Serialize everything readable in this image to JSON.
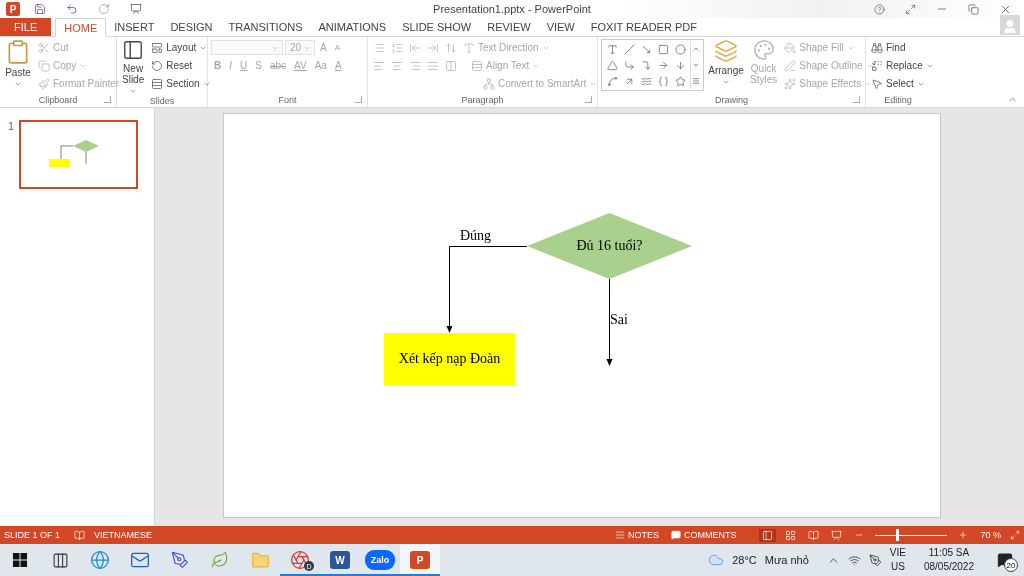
{
  "title_bar": {
    "app_letter": "P",
    "title": "Presentation1.pptx - PowerPoint"
  },
  "tabs": [
    {
      "label": "FILE",
      "kind": "file",
      "selected": false
    },
    {
      "label": "HOME",
      "kind": "tab",
      "selected": true
    },
    {
      "label": "INSERT",
      "kind": "tab",
      "selected": false
    },
    {
      "label": "DESIGN",
      "kind": "tab",
      "selected": false
    },
    {
      "label": "TRANSITIONS",
      "kind": "tab",
      "selected": false
    },
    {
      "label": "ANIMATIONS",
      "kind": "tab",
      "selected": false
    },
    {
      "label": "SLIDE SHOW",
      "kind": "tab",
      "selected": false
    },
    {
      "label": "REVIEW",
      "kind": "tab",
      "selected": false
    },
    {
      "label": "VIEW",
      "kind": "tab",
      "selected": false
    },
    {
      "label": "FOXIT READER PDF",
      "kind": "tab",
      "selected": false
    }
  ],
  "ribbon": {
    "clipboard": {
      "label": "Clipboard",
      "paste": {
        "label": "Paste",
        "disabled": false
      },
      "cut": {
        "label": "Cut",
        "disabled": true
      },
      "copy": {
        "label": "Copy",
        "disabled": true
      },
      "format_painter": {
        "label": "Format Painter",
        "disabled": true
      }
    },
    "slides": {
      "label": "Slides",
      "new_slide": {
        "label": "New Slide",
        "disabled": false
      },
      "layout": {
        "label": "Layout",
        "disabled": false
      },
      "reset": {
        "label": "Reset",
        "disabled": false
      },
      "section": {
        "label": "Section",
        "disabled": false
      }
    },
    "font": {
      "label": "Font",
      "disabled": true,
      "font_size": "20",
      "grow": "A",
      "shrink": "A",
      "format_buttons": [
        "B",
        "I",
        "U",
        "S",
        "abc",
        "AV",
        "Aa"
      ],
      "font_color": "A"
    },
    "paragraph": {
      "label": "Paragraph",
      "disabled": true,
      "text_direction": "Text Direction",
      "align_text": "Align Text",
      "smartart": "Convert to SmartArt"
    },
    "drawing": {
      "label": "Drawing",
      "arrange": {
        "label": "Arrange",
        "disabled": false
      },
      "quick_styles": {
        "label": "Quick Styles",
        "disabled": true
      },
      "shape_fill": {
        "label": "Shape Fill",
        "disabled": true
      },
      "shape_outline": {
        "label": "Shape Outline",
        "disabled": true
      },
      "shape_effects": {
        "label": "Shape Effects",
        "disabled": true
      }
    },
    "editing": {
      "label": "Editing",
      "find": {
        "label": "Find",
        "disabled": false
      },
      "replace": {
        "label": "Replace",
        "disabled": false
      },
      "select": {
        "label": "Select",
        "disabled": false
      }
    }
  },
  "thumbnails": [
    {
      "number": "1",
      "selected": true
    }
  ],
  "slide": {
    "decision": "Đủ 16 tuổi?",
    "action": "Xét kếp nạp Đoàn",
    "yes_label": "Đúng",
    "no_label": "Sai"
  },
  "status_bar": {
    "slide_info": "SLIDE 1 OF 1",
    "language": "VIETNAMESE",
    "notes": "NOTES",
    "comments": "COMMENTS",
    "views": [
      {
        "selected": true
      },
      {
        "selected": false
      },
      {
        "selected": false
      },
      {
        "selected": false
      }
    ],
    "zoom": {
      "level": 0.3,
      "reading": "70 %"
    }
  },
  "taskbar": {
    "apps": [
      {
        "kind": "start",
        "running": false,
        "selected": false
      },
      {
        "kind": "taskview",
        "running": false,
        "selected": false
      },
      {
        "kind": "edge",
        "running": false,
        "selected": false
      },
      {
        "kind": "mail",
        "running": false,
        "selected": false
      },
      {
        "kind": "notes",
        "running": false,
        "selected": false
      },
      {
        "kind": "coccoc",
        "running": false,
        "selected": false
      },
      {
        "kind": "files",
        "running": false,
        "selected": false
      },
      {
        "kind": "chrome",
        "badge": "D",
        "running": true,
        "selected": false
      },
      {
        "kind": "word",
        "label": "W",
        "running": true,
        "selected": false
      },
      {
        "kind": "zalo",
        "label": "Zalo",
        "running": true,
        "selected": false
      },
      {
        "kind": "powerpoint",
        "label": "P",
        "running": true,
        "selected": true
      }
    ],
    "temperature": "28°C",
    "weather": "Mưa nhỏ",
    "language": [
      "VIE",
      "US"
    ],
    "time": "11:05 SA",
    "date": "08/05/2022",
    "notifications": "20"
  }
}
